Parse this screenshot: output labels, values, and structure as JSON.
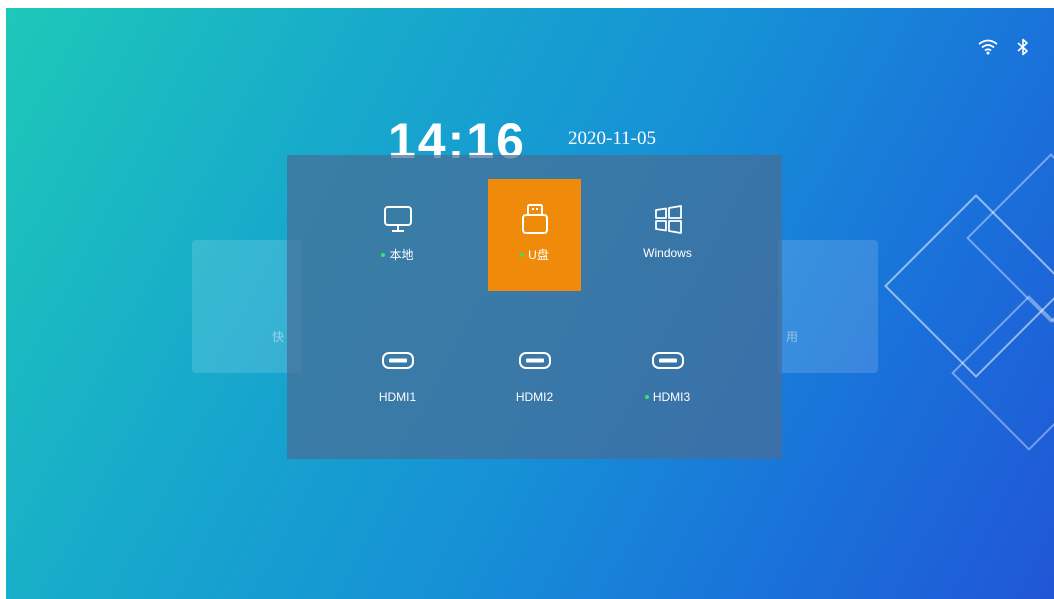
{
  "status": {
    "icons": [
      "wifi-icon",
      "bluetooth-icon"
    ]
  },
  "clock": {
    "time": "14:16",
    "date": "2020-11-05"
  },
  "sources": [
    {
      "label": "本地",
      "icon": "monitor-icon",
      "connected": true
    },
    {
      "label": "U盘",
      "icon": "usb-drive-icon",
      "connected": true,
      "selected": true
    },
    {
      "label": "Windows",
      "icon": "windows-icon",
      "connected": false
    },
    {
      "label": "HDMI1",
      "icon": "hdmi-icon",
      "connected": false
    },
    {
      "label": "HDMI2",
      "icon": "hdmi-icon",
      "connected": false
    },
    {
      "label": "HDMI3",
      "icon": "hdmi-icon",
      "connected": true
    }
  ],
  "background_cards": {
    "left_text": "快",
    "right_text": "用"
  },
  "colors": {
    "selected": "#f08a0a",
    "connected_dot": "#3ee06a"
  }
}
